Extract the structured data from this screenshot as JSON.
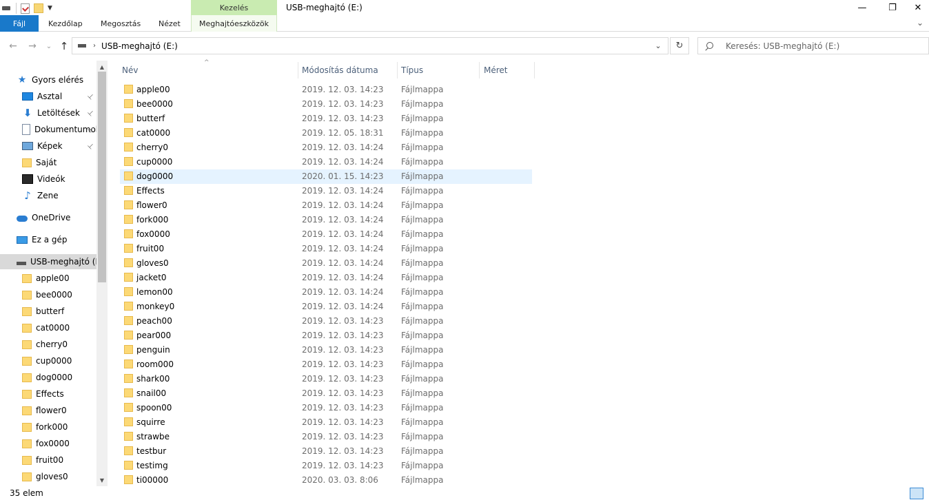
{
  "window": {
    "title": "USB-meghajtó (E:)",
    "contextual_group": "Kezelés",
    "controls": {
      "minimize": "—",
      "restore": "❐",
      "close": "✕"
    }
  },
  "ribbon": {
    "tabs": [
      "Fájl",
      "Kezdőlap",
      "Megosztás",
      "Nézet",
      "Meghajtóeszközök"
    ],
    "expand_glyph": "⌄"
  },
  "navigation": {
    "back": "←",
    "forward": "→",
    "recent": "⌄",
    "up": "↑",
    "address_separator": "›",
    "address": "USB-meghajtó (E:)",
    "address_dropdown": "⌄",
    "refresh": "↻",
    "search_placeholder": "Keresés: USB-meghajtó (E:)"
  },
  "nav_pane": {
    "quick_access": "Gyors elérés",
    "quick_items": [
      {
        "label": "Asztal",
        "icon": "desktop-icon",
        "pinned": true
      },
      {
        "label": "Letöltések",
        "icon": "download-icon",
        "pinned": true
      },
      {
        "label": "Dokumentumok",
        "icon": "document-icon",
        "pinned": true
      },
      {
        "label": "Képek",
        "icon": "pictures-icon",
        "pinned": true
      },
      {
        "label": "Saját",
        "icon": "folder-icon",
        "pinned": false
      },
      {
        "label": "Videók",
        "icon": "videos-icon",
        "pinned": false
      },
      {
        "label": "Zene",
        "icon": "music-icon",
        "pinned": false
      }
    ],
    "onedrive": "OneDrive",
    "this_pc": "Ez a gép",
    "usb": "USB-meghajtó (E:)",
    "usb_children": [
      "apple00",
      "bee0000",
      "butterf",
      "cat0000",
      "cherry0",
      "cup0000",
      "dog0000",
      "Effects",
      "flower0",
      "fork000",
      "fox0000",
      "fruit00",
      "gloves0"
    ],
    "pin_glyph": "📌",
    "scroll_up": "▲",
    "scroll_down": "▼"
  },
  "columns": {
    "name": "Név",
    "modified": "Módosítás dátuma",
    "type": "Típus",
    "size": "Méret",
    "sort_indicator": "^"
  },
  "files": [
    {
      "name": "apple00",
      "modified": "2019. 12. 03. 14:23",
      "type": "Fájlmappa"
    },
    {
      "name": "bee0000",
      "modified": "2019. 12. 03. 14:23",
      "type": "Fájlmappa"
    },
    {
      "name": "butterf",
      "modified": "2019. 12. 03. 14:23",
      "type": "Fájlmappa"
    },
    {
      "name": "cat0000",
      "modified": "2019. 12. 05. 18:31",
      "type": "Fájlmappa"
    },
    {
      "name": "cherry0",
      "modified": "2019. 12. 03. 14:24",
      "type": "Fájlmappa"
    },
    {
      "name": "cup0000",
      "modified": "2019. 12. 03. 14:24",
      "type": "Fájlmappa"
    },
    {
      "name": "dog0000",
      "modified": "2020. 01. 15. 14:23",
      "type": "Fájlmappa",
      "hover": true
    },
    {
      "name": "Effects",
      "modified": "2019. 12. 03. 14:24",
      "type": "Fájlmappa"
    },
    {
      "name": "flower0",
      "modified": "2019. 12. 03. 14:24",
      "type": "Fájlmappa"
    },
    {
      "name": "fork000",
      "modified": "2019. 12. 03. 14:24",
      "type": "Fájlmappa"
    },
    {
      "name": "fox0000",
      "modified": "2019. 12. 03. 14:24",
      "type": "Fájlmappa"
    },
    {
      "name": "fruit00",
      "modified": "2019. 12. 03. 14:24",
      "type": "Fájlmappa"
    },
    {
      "name": "gloves0",
      "modified": "2019. 12. 03. 14:24",
      "type": "Fájlmappa"
    },
    {
      "name": "jacket0",
      "modified": "2019. 12. 03. 14:24",
      "type": "Fájlmappa"
    },
    {
      "name": "lemon00",
      "modified": "2019. 12. 03. 14:24",
      "type": "Fájlmappa"
    },
    {
      "name": "monkey0",
      "modified": "2019. 12. 03. 14:24",
      "type": "Fájlmappa"
    },
    {
      "name": "peach00",
      "modified": "2019. 12. 03. 14:23",
      "type": "Fájlmappa"
    },
    {
      "name": "pear000",
      "modified": "2019. 12. 03. 14:23",
      "type": "Fájlmappa"
    },
    {
      "name": "penguin",
      "modified": "2019. 12. 03. 14:23",
      "type": "Fájlmappa"
    },
    {
      "name": "room000",
      "modified": "2019. 12. 03. 14:23",
      "type": "Fájlmappa"
    },
    {
      "name": "shark00",
      "modified": "2019. 12. 03. 14:23",
      "type": "Fájlmappa"
    },
    {
      "name": "snail00",
      "modified": "2019. 12. 03. 14:23",
      "type": "Fájlmappa"
    },
    {
      "name": "spoon00",
      "modified": "2019. 12. 03. 14:23",
      "type": "Fájlmappa"
    },
    {
      "name": "squirre",
      "modified": "2019. 12. 03. 14:23",
      "type": "Fájlmappa"
    },
    {
      "name": "strawbe",
      "modified": "2019. 12. 03. 14:23",
      "type": "Fájlmappa"
    },
    {
      "name": "testbur",
      "modified": "2019. 12. 03. 14:23",
      "type": "Fájlmappa"
    },
    {
      "name": "testimg",
      "modified": "2019. 12. 03. 14:23",
      "type": "Fájlmappa"
    },
    {
      "name": "ti00000",
      "modified": "2020. 03. 03. 8:06",
      "type": "Fájlmappa"
    }
  ],
  "status": {
    "item_count": "35 elem"
  },
  "colors": {
    "file_tab": "#1979ca",
    "context_tab": "#c9ebb1",
    "hover_row": "#e5f3ff",
    "selected_nav": "#d9d9d9"
  }
}
